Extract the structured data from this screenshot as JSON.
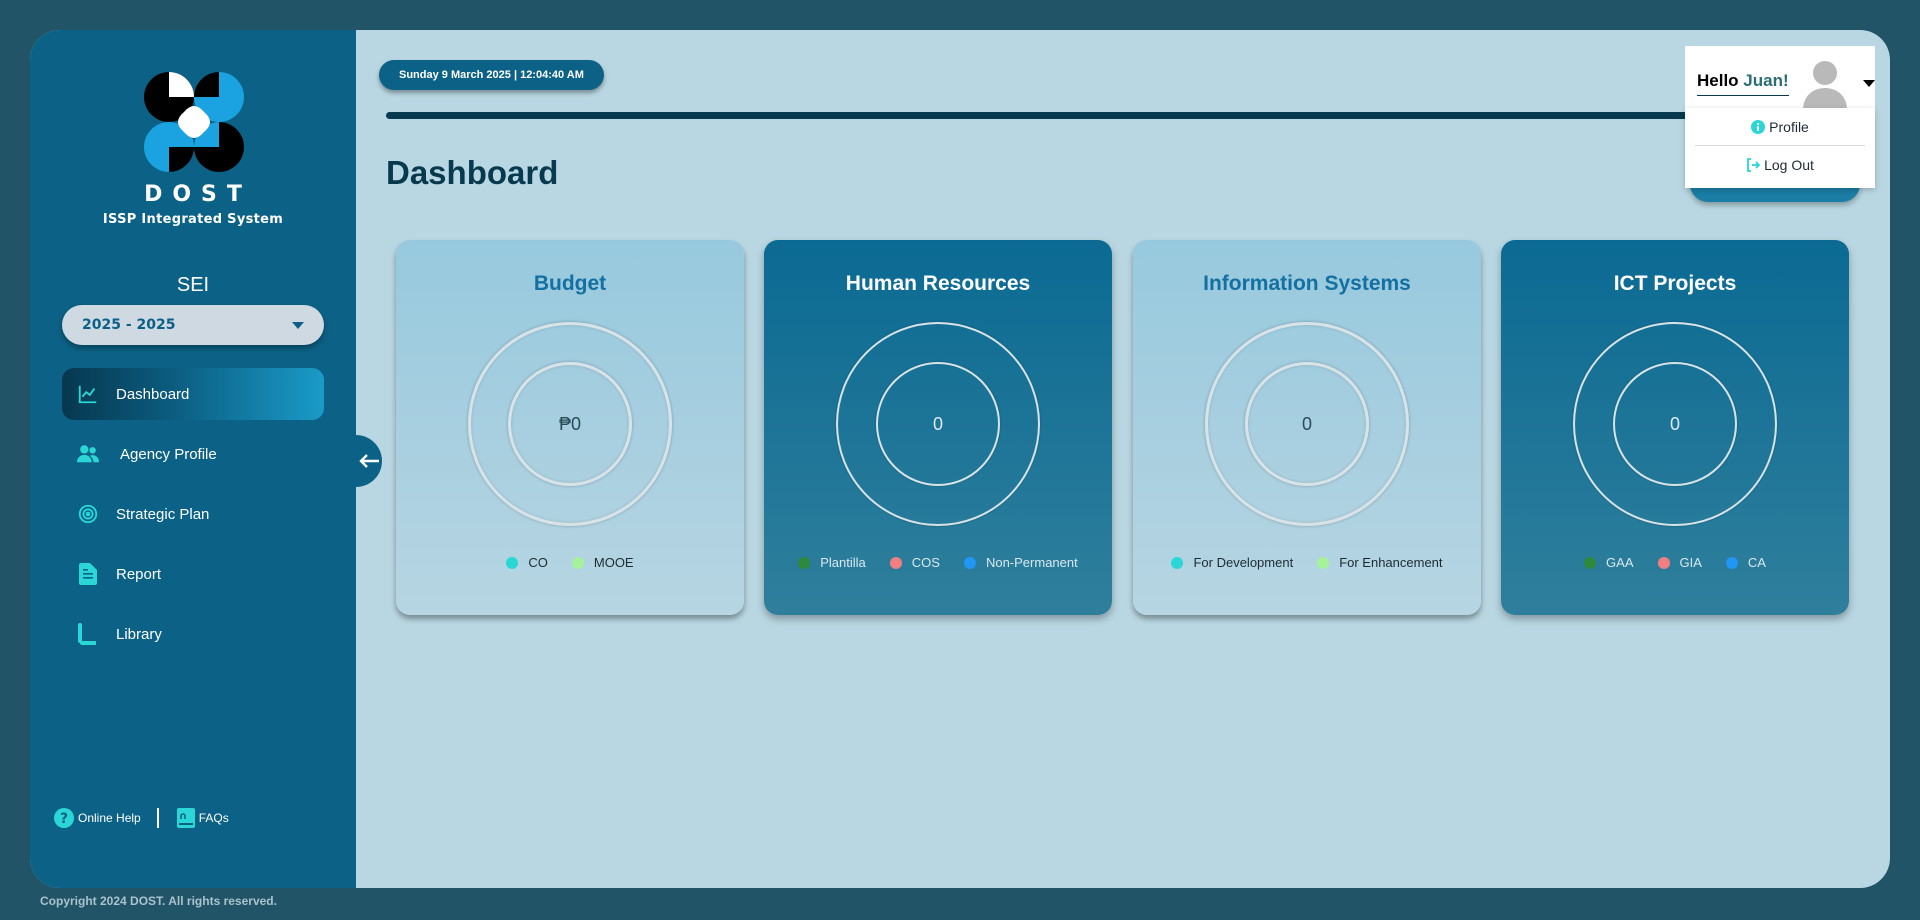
{
  "sidebar": {
    "brand": "DOST",
    "brand_sub": "ISSP Integrated System",
    "agency": "SEI",
    "year_select": "2025 - 2025",
    "nav": [
      {
        "label": "Dashboard",
        "icon": "chart-line-icon"
      },
      {
        "label": "Agency Profile",
        "icon": "users-icon"
      },
      {
        "label": "Strategic Plan",
        "icon": "target-icon"
      },
      {
        "label": "Report",
        "icon": "document-icon"
      },
      {
        "label": "Library",
        "icon": "book-icon"
      }
    ],
    "help_label": "Online Help",
    "faq_label": "FAQs"
  },
  "header": {
    "datetime": "Sunday 9 March 2025 | 12:04:40 AM",
    "hello": "Hello",
    "user_name": "Juan!",
    "menu": {
      "profile": "Profile",
      "logout": "Log Out"
    }
  },
  "page_title": "Dashboard",
  "cards": [
    {
      "title": "Budget",
      "value": "₱0",
      "legend": [
        "CO",
        "MOOE"
      ]
    },
    {
      "title": "Human Resources",
      "value": "0",
      "legend": [
        "Plantilla",
        "COS",
        "Non-Permanent"
      ]
    },
    {
      "title": "Information Systems",
      "value": "0",
      "legend": [
        "For Development",
        "For Enhancement"
      ]
    },
    {
      "title": "ICT Projects",
      "value": "0",
      "legend": [
        "GAA",
        "GIA",
        "CA"
      ]
    }
  ],
  "colors": {
    "teal": "#2ad6d6",
    "light_green": "#a6f29a",
    "green": "#2d8a3c",
    "salmon": "#f07f7f",
    "blue": "#2196f3",
    "sidebar": "#0c6286"
  },
  "footer": "Copyright 2024 DOST. All rights reserved."
}
